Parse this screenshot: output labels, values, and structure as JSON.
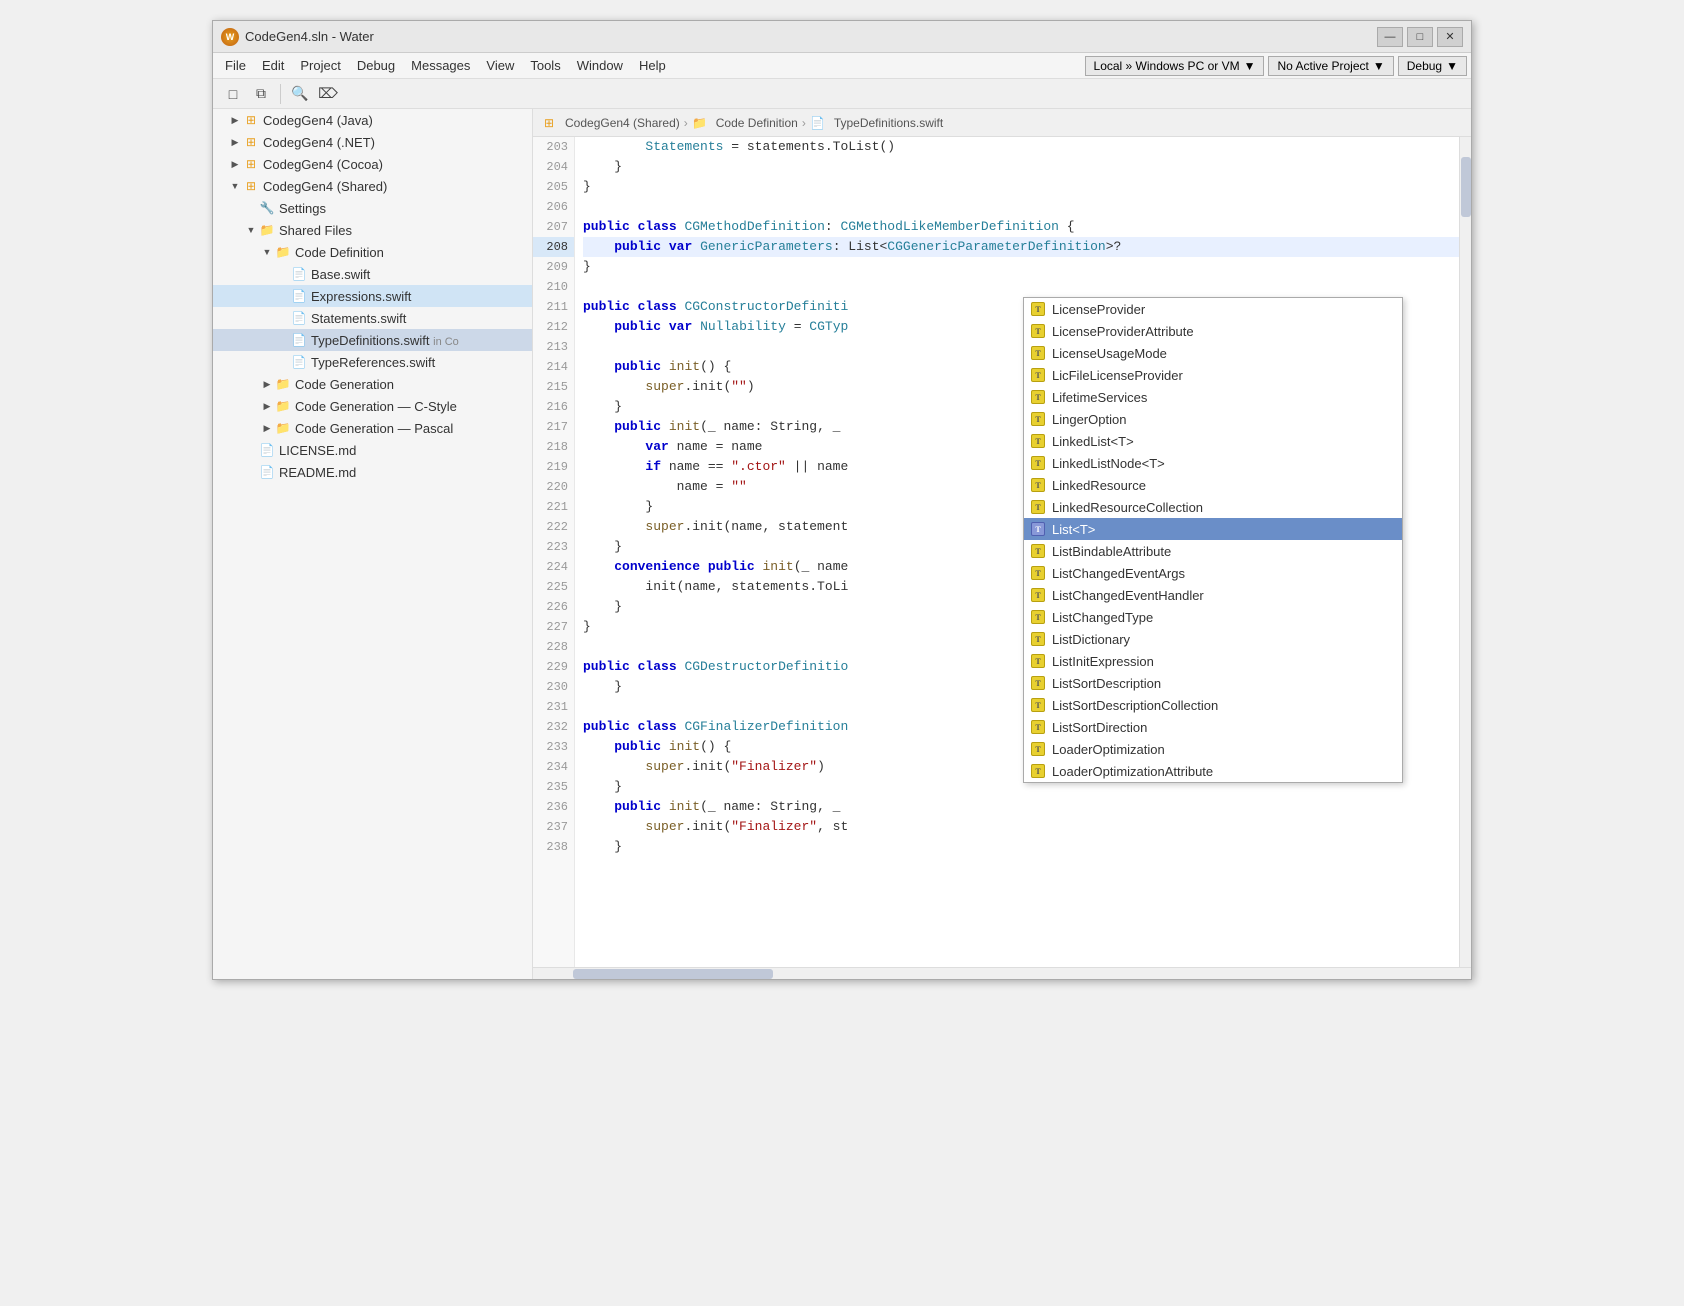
{
  "window": {
    "title": "CodeGen4.sln - Water",
    "minimize": "—",
    "maximize": "□",
    "close": "✕"
  },
  "menubar": {
    "items": [
      "File",
      "Edit",
      "Project",
      "Debug",
      "Messages",
      "View",
      "Tools",
      "Window",
      "Help"
    ],
    "dropdowns": [
      {
        "label": "Local » Windows PC or VM",
        "arrow": "▼"
      },
      {
        "label": "No Active Project",
        "arrow": "▼"
      },
      {
        "label": "Debug",
        "arrow": "▼"
      }
    ]
  },
  "toolbar": {
    "buttons": [
      "□",
      "⧉",
      "🔍",
      "⌦"
    ]
  },
  "breadcrumb": {
    "items": [
      {
        "icon": "project-icon",
        "label": "CodegGen4 (Shared)"
      },
      {
        "icon": "folder-icon",
        "label": "Code Definition"
      },
      {
        "icon": "file-icon",
        "label": "TypeDefinitions.swift"
      }
    ]
  },
  "sidebar": {
    "items": [
      {
        "level": 1,
        "type": "project",
        "label": "CodegGen4 (Java)",
        "expanded": false
      },
      {
        "level": 1,
        "type": "project",
        "label": "CodegGen4 (.NET)",
        "expanded": false
      },
      {
        "level": 1,
        "type": "project",
        "label": "CodegGen4 (Cocoa)",
        "expanded": false
      },
      {
        "level": 1,
        "type": "project",
        "label": "CodegGen4 (Shared)",
        "expanded": true
      },
      {
        "level": 2,
        "type": "settings",
        "label": "Settings"
      },
      {
        "level": 2,
        "type": "folder",
        "label": "Shared Files",
        "expanded": true
      },
      {
        "level": 3,
        "type": "folder",
        "label": "Code Definition",
        "expanded": true
      },
      {
        "level": 4,
        "type": "file",
        "label": "Base.swift"
      },
      {
        "level": 4,
        "type": "file",
        "label": "Expressions.swift",
        "highlighted": true
      },
      {
        "level": 4,
        "type": "file",
        "label": "Statements.swift"
      },
      {
        "level": 4,
        "type": "file",
        "label": "TypeDefinitions.swift",
        "badge": "in Co"
      },
      {
        "level": 4,
        "type": "file",
        "label": "TypeReferences.swift"
      },
      {
        "level": 3,
        "type": "folder",
        "label": "Code Generation"
      },
      {
        "level": 3,
        "type": "folder",
        "label": "Code Generation — C-Style"
      },
      {
        "level": 3,
        "type": "folder",
        "label": "Code Generation — Pascal"
      },
      {
        "level": 2,
        "type": "file",
        "label": "LICENSE.md"
      },
      {
        "level": 2,
        "type": "file",
        "label": "README.md"
      }
    ]
  },
  "code": {
    "lines": [
      {
        "num": 203,
        "content": "        Statements = statements.ToList()"
      },
      {
        "num": 204,
        "content": "    }"
      },
      {
        "num": 205,
        "content": "}"
      },
      {
        "num": 206,
        "content": ""
      },
      {
        "num": 207,
        "content": "public class CGMethodDefinition: CGMethodLikeMemberDefinition {"
      },
      {
        "num": 208,
        "content": "    public var GenericParameters: List<CGGenericParameterDefinition>?"
      },
      {
        "num": 209,
        "content": "}"
      },
      {
        "num": 210,
        "content": ""
      },
      {
        "num": 211,
        "content": "public class CGConstructorDefiniti"
      },
      {
        "num": 212,
        "content": "    public var Nullability = CGTyp"
      },
      {
        "num": 213,
        "content": ""
      },
      {
        "num": 214,
        "content": "    public init() {"
      },
      {
        "num": 215,
        "content": "        super.init(\"\")"
      },
      {
        "num": 216,
        "content": "    }"
      },
      {
        "num": 217,
        "content": "    public init(_ name: String, _"
      },
      {
        "num": 218,
        "content": "        var name = name"
      },
      {
        "num": 219,
        "content": "        if name == \".ctor\" || name"
      },
      {
        "num": 220,
        "content": "            name = \"\""
      },
      {
        "num": 221,
        "content": "        }"
      },
      {
        "num": 222,
        "content": "        super.init(name, statement"
      },
      {
        "num": 223,
        "content": "    }"
      },
      {
        "num": 224,
        "content": "    convenience public init(_ name"
      },
      {
        "num": 225,
        "content": "        init(name, statements.ToLi"
      },
      {
        "num": 226,
        "content": "    }"
      },
      {
        "num": 227,
        "content": "}"
      },
      {
        "num": 228,
        "content": ""
      },
      {
        "num": 229,
        "content": "public class CGDestructorDefinitio"
      },
      {
        "num": 230,
        "content": "    }"
      },
      {
        "num": 231,
        "content": ""
      },
      {
        "num": 232,
        "content": "public class CGFinalizerDefinition"
      },
      {
        "num": 233,
        "content": "    public init() {"
      },
      {
        "num": 234,
        "content": "        super.init(\"Finalizer\")"
      },
      {
        "num": 235,
        "content": "    }"
      },
      {
        "num": 236,
        "content": "    public init(_ name: String, _"
      },
      {
        "num": 237,
        "content": "        super.init(\"Finalizer\", st"
      },
      {
        "num": 238,
        "content": "    }"
      }
    ]
  },
  "autocomplete": {
    "items": [
      {
        "label": "LicenseProvider",
        "selected": false
      },
      {
        "label": "LicenseProviderAttribute",
        "selected": false
      },
      {
        "label": "LicenseUsageMode",
        "selected": false
      },
      {
        "label": "LicFileLicenseProvider",
        "selected": false
      },
      {
        "label": "LifetimeServices",
        "selected": false
      },
      {
        "label": "LingerOption",
        "selected": false
      },
      {
        "label": "LinkedList<T>",
        "selected": false
      },
      {
        "label": "LinkedListNode<T>",
        "selected": false
      },
      {
        "label": "LinkedResource",
        "selected": false
      },
      {
        "label": "LinkedResourceCollection",
        "selected": false
      },
      {
        "label": "List<T>",
        "selected": true
      },
      {
        "label": "ListBindableAttribute",
        "selected": false
      },
      {
        "label": "ListChangedEventArgs",
        "selected": false
      },
      {
        "label": "ListChangedEventHandler",
        "selected": false
      },
      {
        "label": "ListChangedType",
        "selected": false
      },
      {
        "label": "ListDictionary",
        "selected": false
      },
      {
        "label": "ListInitExpression",
        "selected": false
      },
      {
        "label": "ListSortDescription",
        "selected": false
      },
      {
        "label": "ListSortDescriptionCollection",
        "selected": false
      },
      {
        "label": "ListSortDirection",
        "selected": false
      },
      {
        "label": "LoaderOptimization",
        "selected": false
      },
      {
        "label": "LoaderOptimizationAttribute",
        "selected": false
      }
    ]
  }
}
